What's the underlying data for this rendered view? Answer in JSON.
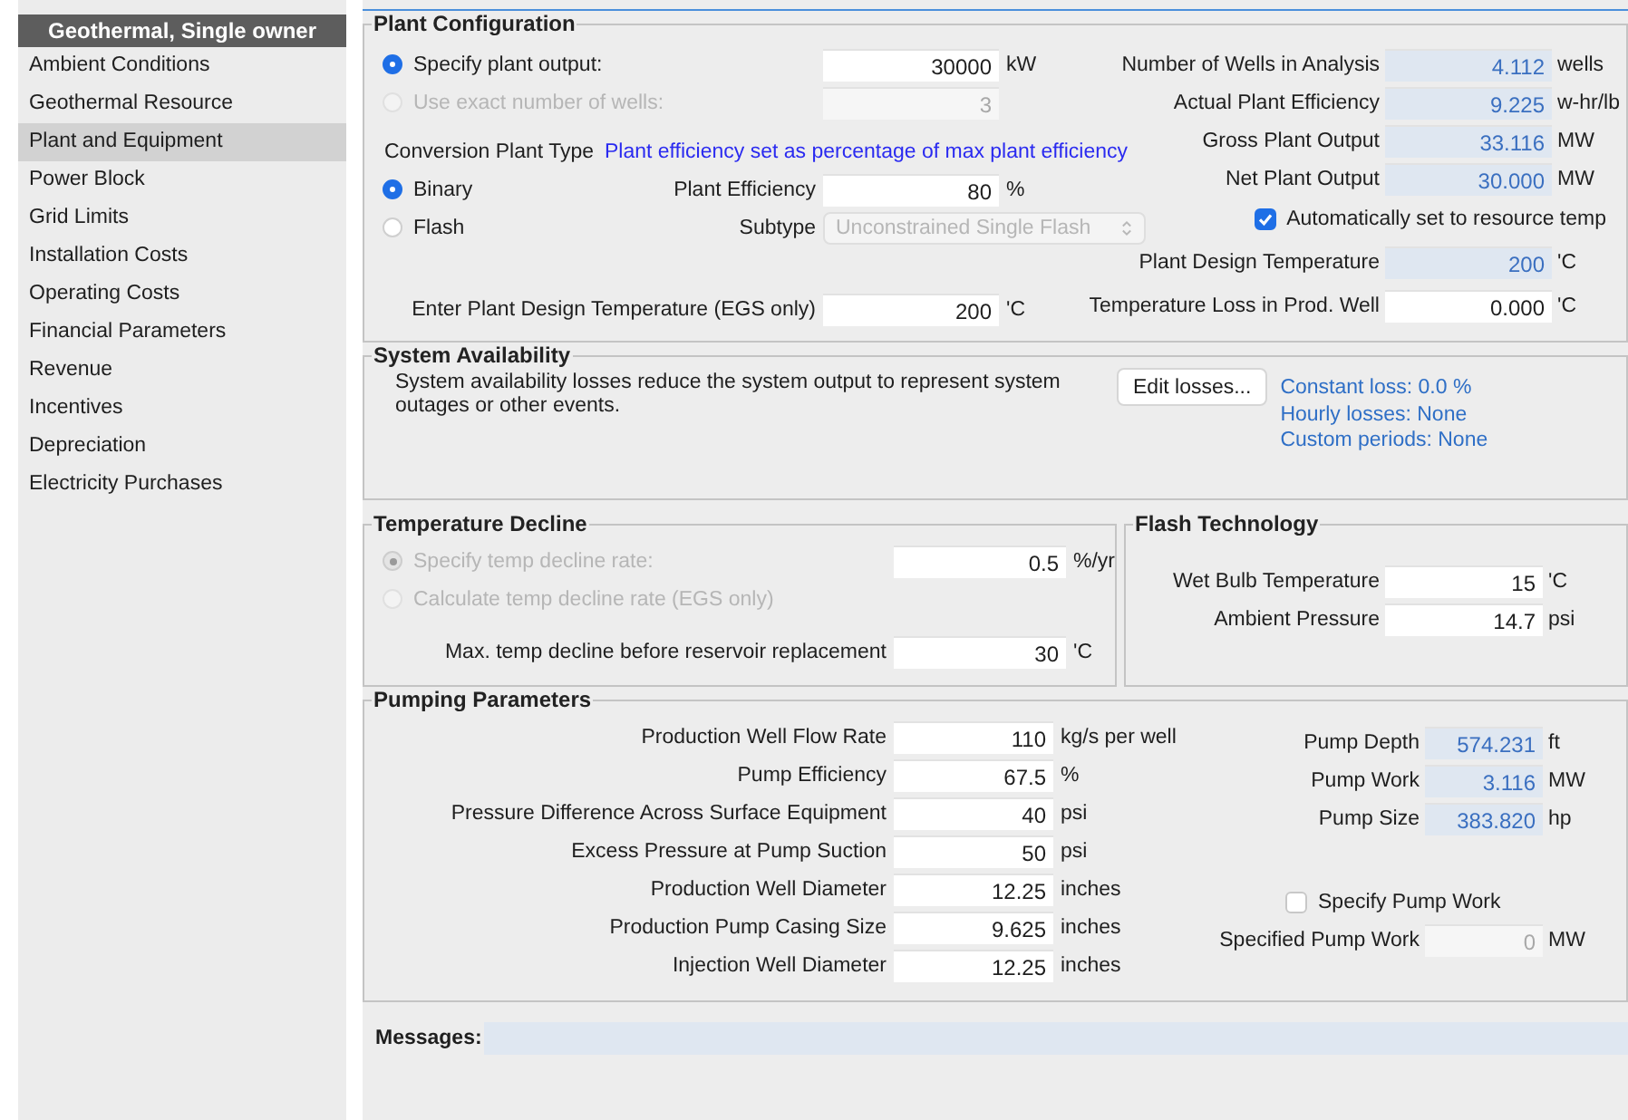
{
  "sidebar": {
    "header": "Geothermal, Single owner",
    "items": [
      {
        "label": "Ambient Conditions",
        "selected": false
      },
      {
        "label": "Geothermal Resource",
        "selected": false
      },
      {
        "label": "Plant and Equipment",
        "selected": true
      },
      {
        "label": "Power Block",
        "selected": false
      },
      {
        "label": "Grid Limits",
        "selected": false
      },
      {
        "label": "Installation Costs",
        "selected": false
      },
      {
        "label": "Operating Costs",
        "selected": false
      },
      {
        "label": "Financial Parameters",
        "selected": false
      },
      {
        "label": "Revenue",
        "selected": false
      },
      {
        "label": "Incentives",
        "selected": false
      },
      {
        "label": "Depreciation",
        "selected": false
      },
      {
        "label": "Electricity Purchases",
        "selected": false
      }
    ]
  },
  "plant_configuration": {
    "title": "Plant Configuration",
    "output_options": [
      {
        "label": "Specify plant output:",
        "selected": true,
        "value": "30000",
        "unit": "kW",
        "disabled": false
      },
      {
        "label": "Use exact number of wells:",
        "selected": false,
        "value": "3",
        "disabled": true
      }
    ],
    "conversion_label": "Conversion Plant Type",
    "efficiency_note": "Plant efficiency set as percentage of max plant efficiency",
    "plant_types": [
      {
        "label": "Binary",
        "selected": true
      },
      {
        "label": "Flash",
        "selected": false
      }
    ],
    "plant_efficiency": {
      "label": "Plant Efficiency",
      "value": "80",
      "unit": "%"
    },
    "subtype": {
      "label": "Subtype",
      "value": "Unconstrained Single Flash",
      "disabled": true
    },
    "egs_temperature": {
      "label": "Enter Plant Design Temperature (EGS only)",
      "value": "200",
      "unit": "'C"
    },
    "results": [
      {
        "label": "Number of Wells in Analysis",
        "value": "4.112",
        "unit": "wells"
      },
      {
        "label": "Actual Plant Efficiency",
        "value": "9.225",
        "unit": "w-hr/lb"
      },
      {
        "label": "Gross Plant Output",
        "value": "33.116",
        "unit": "MW"
      },
      {
        "label": "Net Plant Output",
        "value": "30.000",
        "unit": "MW"
      }
    ],
    "auto_temp": {
      "label": "Automatically set to resource temp",
      "checked": true
    },
    "design": [
      {
        "label": "Plant Design Temperature",
        "value": "200",
        "unit": "'C",
        "kind": "output"
      },
      {
        "label": "Temperature Loss in Prod. Well",
        "value": "0.000",
        "unit": "'C",
        "kind": "input"
      }
    ]
  },
  "system_availability": {
    "title": "System Availability",
    "description": "System availability losses reduce the system output to represent system outages or other events.",
    "button": "Edit losses...",
    "links": [
      "Constant loss: 0.0 %",
      "Hourly losses: None",
      "Custom periods: None"
    ]
  },
  "temperature_decline": {
    "title": "Temperature Decline",
    "options": [
      {
        "label": "Specify temp decline rate:",
        "selected": true,
        "disabled": true
      },
      {
        "label": "Calculate temp decline rate (EGS only)",
        "selected": false,
        "disabled": true
      }
    ],
    "rate": {
      "value": "0.5",
      "unit": "%/yr"
    },
    "max_decline": {
      "label": "Max. temp decline before reservoir replacement",
      "value": "30",
      "unit": "'C"
    }
  },
  "flash_technology": {
    "title": "Flash Technology",
    "fields": [
      {
        "label": "Wet Bulb Temperature",
        "value": "15",
        "unit": "'C"
      },
      {
        "label": "Ambient Pressure",
        "value": "14.7",
        "unit": "psi"
      }
    ]
  },
  "pumping_parameters": {
    "title": "Pumping Parameters",
    "inputs": [
      {
        "label": "Production Well Flow Rate",
        "value": "110",
        "unit": "kg/s per well"
      },
      {
        "label": "Pump Efficiency",
        "value": "67.5",
        "unit": "%"
      },
      {
        "label": "Pressure Difference Across Surface Equipment",
        "value": "40",
        "unit": "psi"
      },
      {
        "label": "Excess Pressure at Pump Suction",
        "value": "50",
        "unit": "psi"
      },
      {
        "label": "Production Well Diameter",
        "value": "12.25",
        "unit": "inches"
      },
      {
        "label": "Production Pump Casing Size",
        "value": "9.625",
        "unit": "inches"
      },
      {
        "label": "Injection Well Diameter",
        "value": "12.25",
        "unit": "inches"
      }
    ],
    "outputs": [
      {
        "label": "Pump Depth",
        "value": "574.231",
        "unit": "ft"
      },
      {
        "label": "Pump Work",
        "value": "3.116",
        "unit": "MW"
      },
      {
        "label": "Pump Size",
        "value": "383.820",
        "unit": "hp"
      }
    ],
    "specify_pump_work": {
      "label": "Specify Pump Work",
      "checked": false
    },
    "specified_pump_work": {
      "label": "Specified Pump Work",
      "value": "0",
      "unit": "MW",
      "disabled": true
    }
  },
  "messages": {
    "label": "Messages:"
  }
}
